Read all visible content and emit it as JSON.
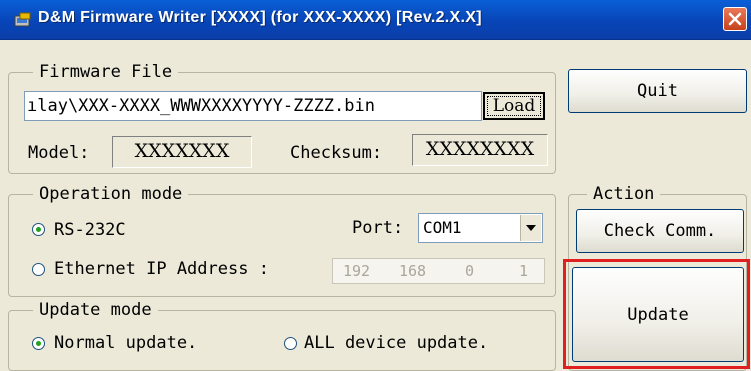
{
  "window": {
    "title": "D&M Firmware Writer [XXXX] (for XXX-XXXX) [Rev.2.X.X]",
    "close_icon": "close-icon"
  },
  "firmware_file": {
    "legend": "Firmware File",
    "path": "ılay\\XXX-XXXX_WWWXXXXYYYY-ZZZZ.bin",
    "load_label": "Load",
    "model_label": "Model:",
    "model_value": "XXXXXXX",
    "checksum_label": "Checksum:",
    "checksum_value": "XXXXXXXX"
  },
  "quit_label": "Quit",
  "operation_mode": {
    "legend": "Operation mode",
    "rs232_label": "RS-232C",
    "rs232_selected": true,
    "port_label": "Port:",
    "port_value": "COM1",
    "ethernet_label": "Ethernet IP Address :",
    "ethernet_selected": false,
    "ip": [
      "192",
      "168",
      "0",
      "1"
    ]
  },
  "action": {
    "legend": "Action",
    "check_comm_label": "Check Comm.",
    "update_label": "Update",
    "highlight_color": "#e02020"
  },
  "update_mode": {
    "legend": "Update mode",
    "normal_label": "Normal update.",
    "normal_selected": true,
    "all_label": "ALL device update.",
    "all_selected": false
  }
}
